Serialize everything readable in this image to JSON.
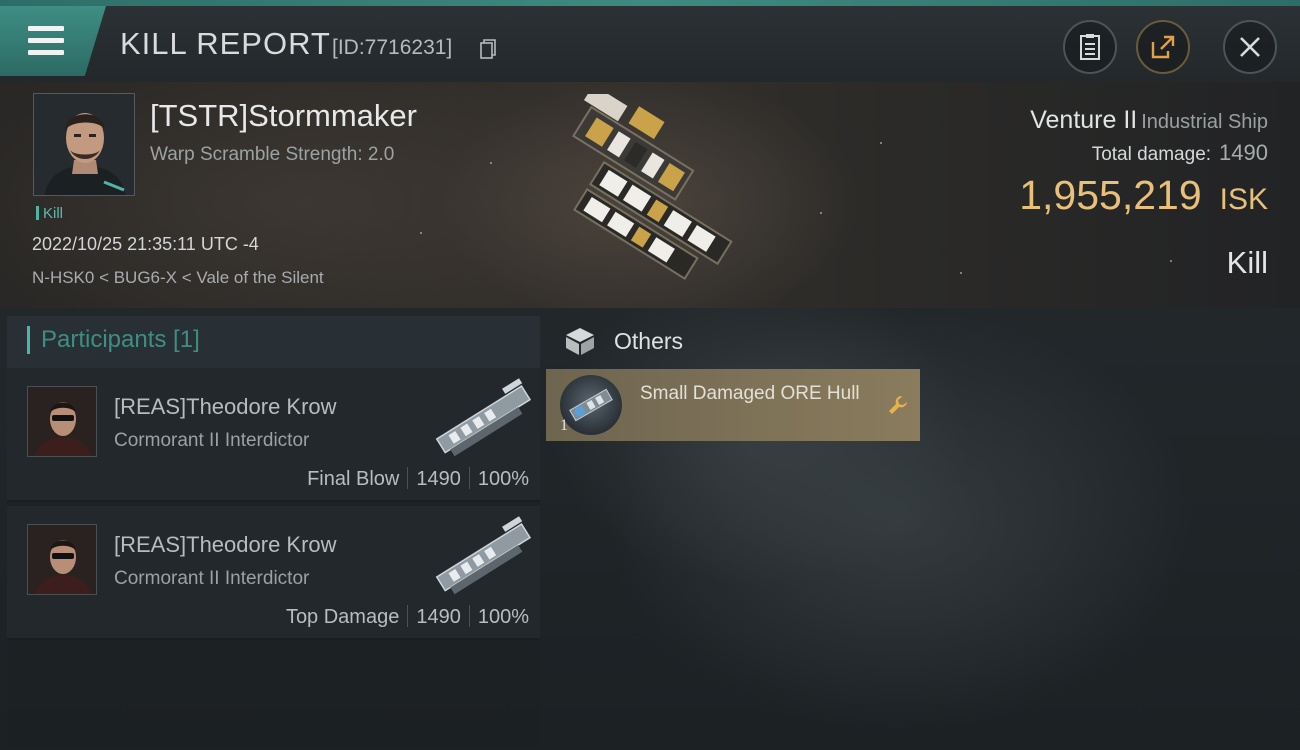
{
  "header": {
    "title": "KILL REPORT",
    "report_id": "[ID:7716231]",
    "buttons": [
      "clipboard-icon",
      "share-icon",
      "close-icon"
    ]
  },
  "victim": {
    "name": "[TSTR]Stormmaker",
    "warp_scramble": "Warp Scramble Strength: 2.0",
    "tag": "Kill",
    "timestamp": "2022/10/25 21:35:11 UTC -4",
    "location": "N-HSK0 < BUG6-X < Vale of the Silent",
    "ship_name": "Venture II",
    "ship_class": "Industrial Ship",
    "total_damage_label": "Total damage:",
    "total_damage": "1490",
    "isk_value": "1,955,219",
    "isk_unit": "ISK",
    "result": "Kill"
  },
  "participants": {
    "title": "Participants [1]",
    "rows": [
      {
        "name": "[REAS]Theodore Krow",
        "ship": "Cormorant II Interdictor",
        "role": "Final Blow",
        "damage": "1490",
        "percent": "100%"
      },
      {
        "name": "[REAS]Theodore Krow",
        "ship": "Cormorant II Interdictor",
        "role": "Top Damage",
        "damage": "1490",
        "percent": "100%"
      }
    ]
  },
  "others": {
    "title": "Others",
    "items": [
      {
        "quantity": "1",
        "name": "Small Damaged ORE Hull",
        "icon": "wrench-icon"
      }
    ]
  },
  "colors": {
    "accent": "#3f8d84",
    "isk": "#e9c07a",
    "item_card": "#8a7c5d"
  }
}
